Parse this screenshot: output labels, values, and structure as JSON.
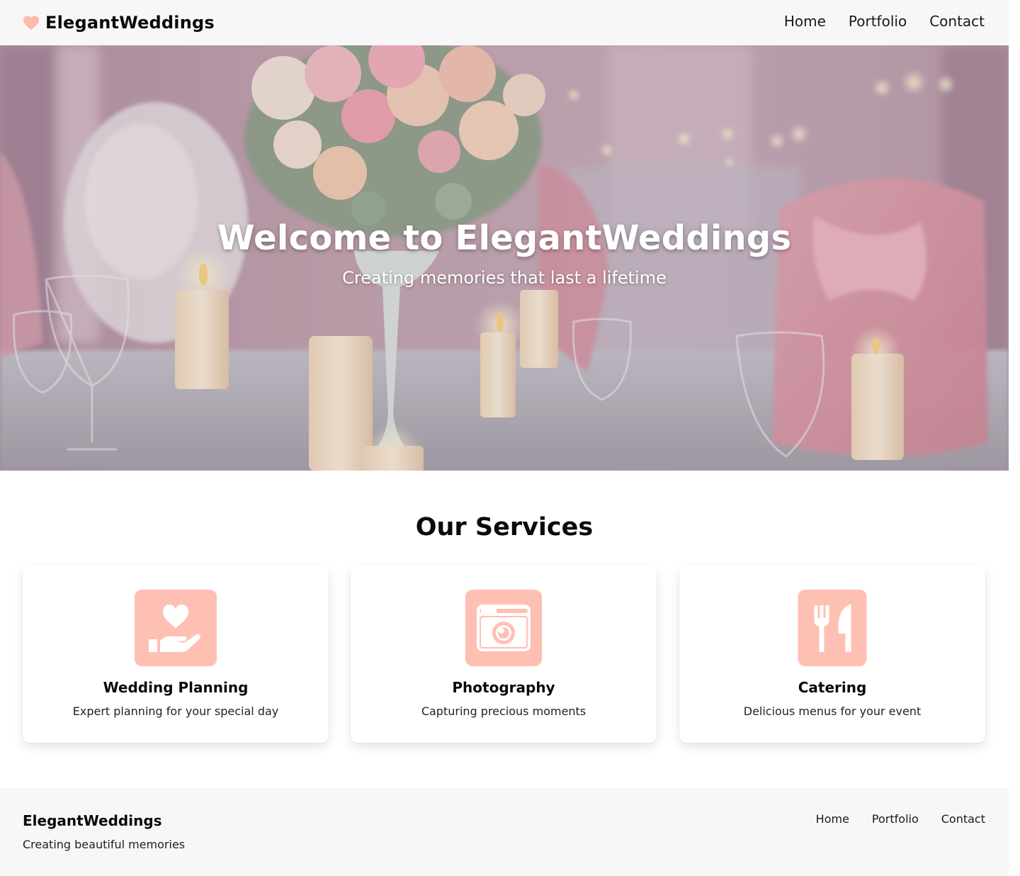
{
  "header": {
    "brand": "ElegantWeddings",
    "nav": [
      "Home",
      "Portfolio",
      "Contact"
    ]
  },
  "hero": {
    "title": "Welcome to ElegantWeddings",
    "subtitle": "Creating memories that last a lifetime"
  },
  "services": {
    "title": "Our Services",
    "items": [
      {
        "title": "Wedding Planning",
        "description": "Expert planning for your special day",
        "icon": "heart-hand-icon"
      },
      {
        "title": "Photography",
        "description": "Capturing precious moments",
        "icon": "camera-icon"
      },
      {
        "title": "Catering",
        "description": "Delicious menus for your event",
        "icon": "utensils-icon"
      }
    ]
  },
  "footer": {
    "brand": "ElegantWeddings",
    "tagline": "Creating beautiful memories",
    "nav": [
      "Home",
      "Portfolio",
      "Contact"
    ]
  },
  "colors": {
    "accent": "#fec0b3",
    "header_bg": "#f7f7f7",
    "footer_bg": "#f7f7f7"
  }
}
